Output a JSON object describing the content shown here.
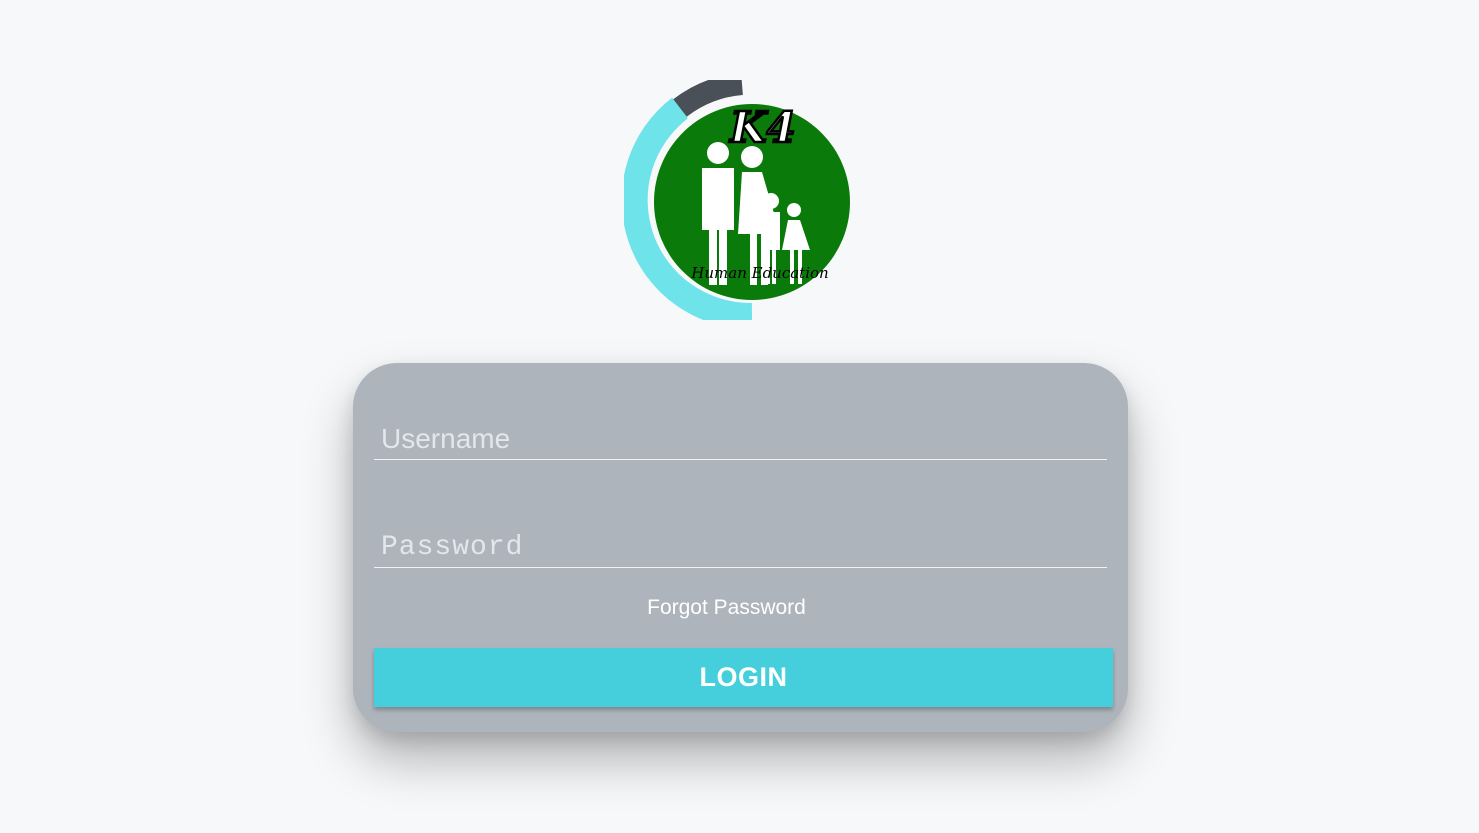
{
  "logo": {
    "mark": "K4",
    "caption": "Human Education",
    "colors": {
      "circle": "#0a7a0a",
      "ring": "#6ee3ea",
      "ring_dark": "#4a5058",
      "figures": "#ffffff"
    }
  },
  "login_form": {
    "username": {
      "placeholder": "Username",
      "value": ""
    },
    "password": {
      "placeholder": "Password",
      "value": ""
    },
    "forgot_password_label": "Forgot Password",
    "login_button_label": "LOGIN"
  },
  "colors": {
    "background": "#f7f8fa",
    "card": "#adb4bc",
    "accent": "#45cfdc"
  }
}
